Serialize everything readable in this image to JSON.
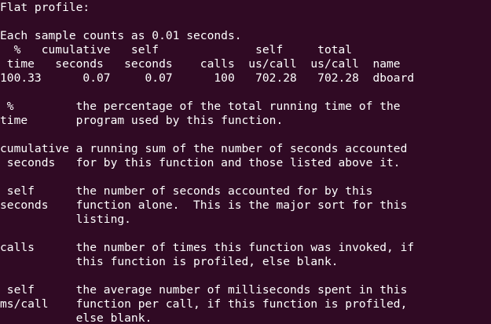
{
  "colors": {
    "background": "#300a24",
    "foreground": "#ffffff"
  },
  "terminal": {
    "lines": [
      "Flat profile:",
      "",
      "Each sample counts as 0.01 seconds.",
      "  %   cumulative   self              self     total",
      " time   seconds   seconds    calls  us/call  us/call  name",
      "100.33      0.07     0.07      100   702.28   702.28  dboard",
      "",
      " %         the percentage of the total running time of the",
      "time       program used by this function.",
      "",
      "cumulative a running sum of the number of seconds accounted",
      " seconds   for by this function and those listed above it.",
      "",
      " self      the number of seconds accounted for by this",
      "seconds    function alone.  This is the major sort for this",
      "           listing.",
      "",
      "calls      the number of times this function was invoked, if",
      "           this function is profiled, else blank.",
      "",
      " self      the average number of milliseconds spent in this",
      "ms/call    function per call, if this function is profiled,",
      "           else blank."
    ]
  }
}
